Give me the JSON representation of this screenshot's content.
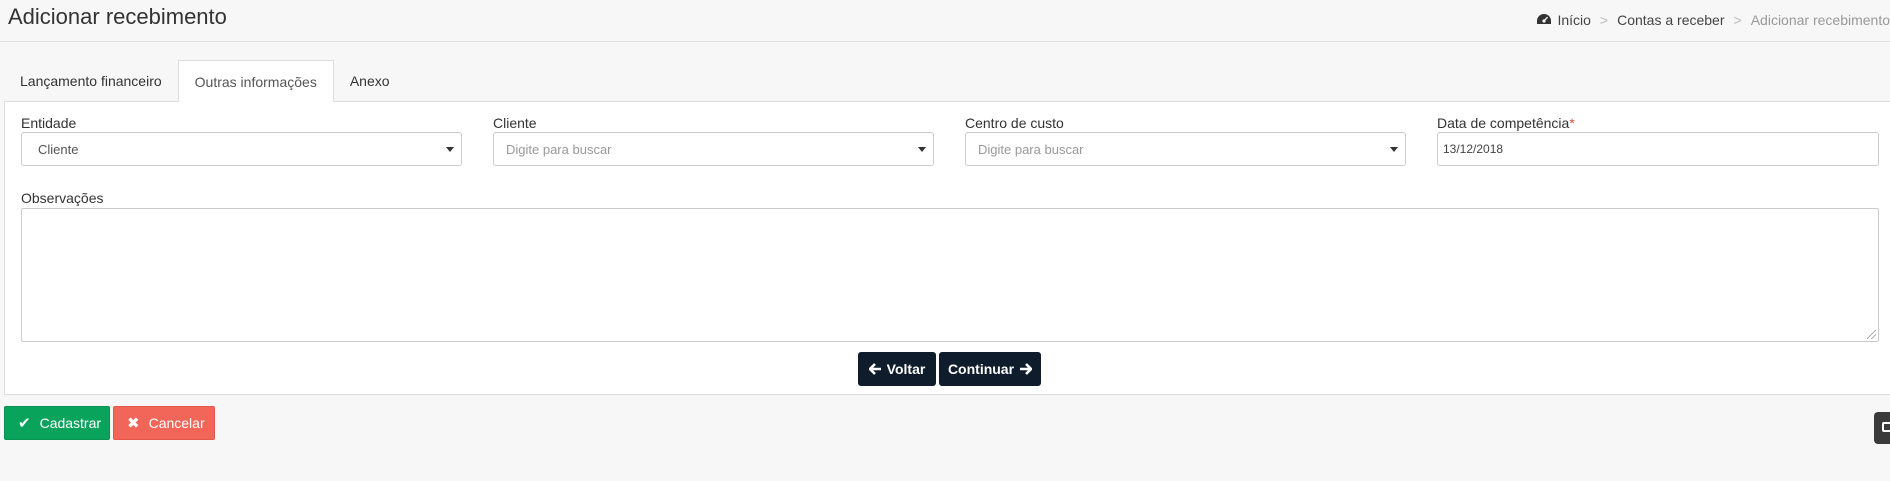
{
  "header": {
    "title": "Adicionar recebimento",
    "breadcrumb": {
      "home": "Início",
      "parent": "Contas a receber",
      "current": "Adicionar recebimento",
      "separator": ">"
    }
  },
  "tabs": [
    {
      "label": "Lançamento financeiro"
    },
    {
      "label": "Outras informações",
      "active": true
    },
    {
      "label": "Anexo"
    }
  ],
  "form": {
    "entidade": {
      "label": "Entidade",
      "value": "Cliente"
    },
    "cliente": {
      "label": "Cliente",
      "placeholder": "Digite para buscar"
    },
    "centro_custo": {
      "label": "Centro de custo",
      "placeholder": "Digite para buscar"
    },
    "data_competencia": {
      "label": "Data de competência",
      "required_mark": "*",
      "value": "13/12/2018"
    },
    "observacoes": {
      "label": "Observações",
      "value": ""
    }
  },
  "nav_buttons": {
    "back": "Voltar",
    "next": "Continuar"
  },
  "actions": {
    "save": "Cadastrar",
    "cancel": "Cancelar"
  },
  "icons": {
    "home": "dashboard-icon",
    "back": "arrow-left-icon",
    "next": "arrow-right-icon",
    "save": "check-icon",
    "cancel": "times-icon",
    "floating": "window-icon"
  },
  "colors": {
    "dark_button": "#0e1c2c",
    "save": "#0aa35c",
    "cancel": "#f2665a",
    "required": "#d9534f"
  }
}
